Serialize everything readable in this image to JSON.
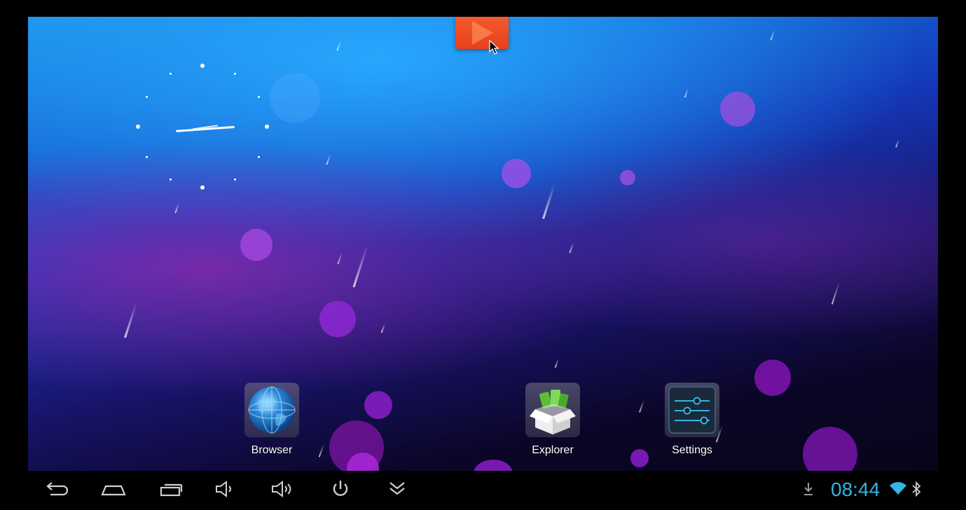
{
  "home": {
    "apps": [
      {
        "name": "browser",
        "label": "Browser",
        "icon": "globe-icon"
      },
      {
        "name": "explorer",
        "label": "Explorer",
        "icon": "package-box-icon"
      },
      {
        "name": "settings",
        "label": "Settings",
        "icon": "sliders-icon"
      }
    ],
    "top_tab_icon": "app-drawer-arrow-icon"
  },
  "navbar": {
    "buttons": [
      "back-icon",
      "home-icon",
      "recent-apps-icon",
      "volume-down-icon",
      "volume-up-icon",
      "power-icon",
      "expand-down-icon"
    ]
  },
  "status": {
    "time": "08:44",
    "icons": [
      "download-icon",
      "wifi-icon",
      "bluetooth-icon"
    ]
  },
  "colors": {
    "accent": "#33b5e5",
    "top_tab": "#e8401c"
  }
}
